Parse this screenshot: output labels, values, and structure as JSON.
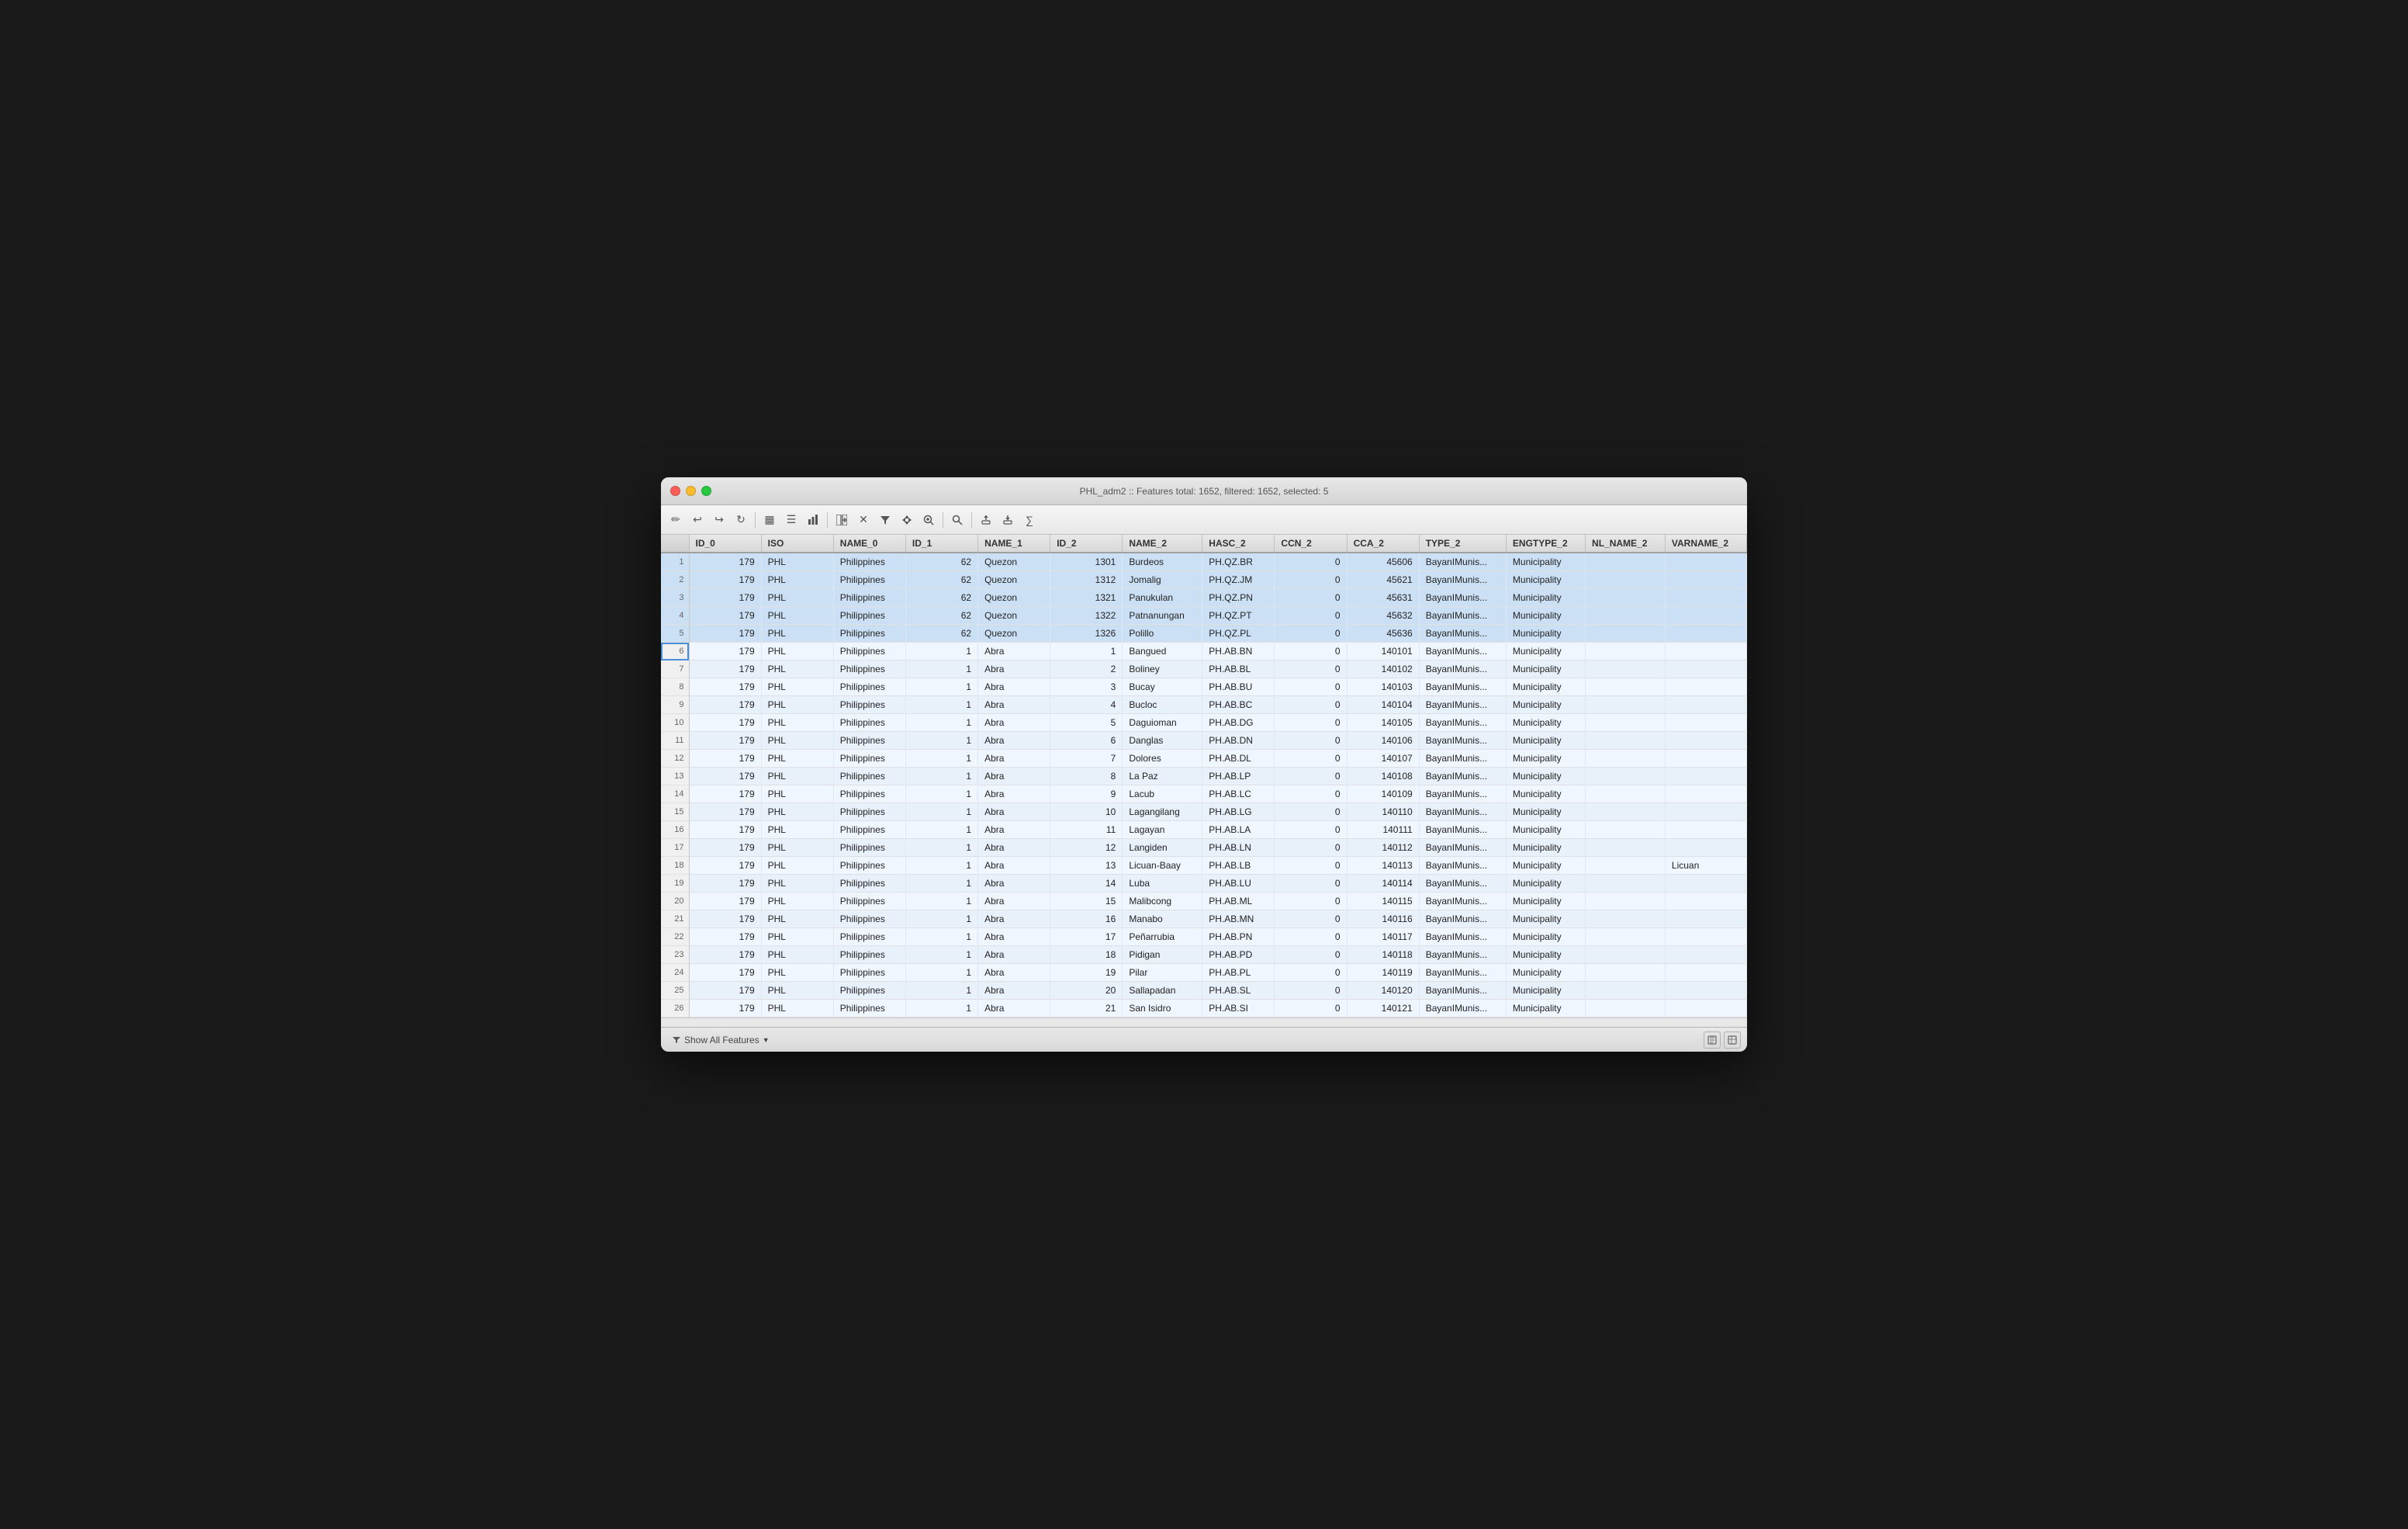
{
  "window": {
    "title": "PHL_adm2 :: Features total: 1652, filtered: 1652, selected: 5"
  },
  "toolbar": {
    "buttons": [
      {
        "name": "pencil-icon",
        "symbol": "✏️"
      },
      {
        "name": "undo-icon",
        "symbol": "↩"
      },
      {
        "name": "redo-icon",
        "symbol": "↪"
      },
      {
        "name": "refresh-icon",
        "symbol": "↻"
      },
      {
        "name": "sep1",
        "type": "separator"
      },
      {
        "name": "table-icon",
        "symbol": "▦"
      },
      {
        "name": "form-icon",
        "symbol": "☰"
      },
      {
        "name": "graph-icon",
        "symbol": "≡"
      },
      {
        "name": "sep2",
        "type": "separator"
      },
      {
        "name": "add-col-icon",
        "symbol": "⊞"
      },
      {
        "name": "delete-icon",
        "symbol": "✕"
      },
      {
        "name": "filter-icon",
        "symbol": "⋮"
      },
      {
        "name": "sep3",
        "type": "separator"
      },
      {
        "name": "move-icon",
        "symbol": "⇄"
      },
      {
        "name": "zoom-icon",
        "symbol": "⊕"
      },
      {
        "name": "sep4",
        "type": "separator"
      },
      {
        "name": "search-icon",
        "symbol": "🔍"
      },
      {
        "name": "sep5",
        "type": "separator"
      },
      {
        "name": "export-icon",
        "symbol": "⬆"
      },
      {
        "name": "import-icon",
        "symbol": "⬇"
      },
      {
        "name": "calc-icon",
        "symbol": "∑"
      }
    ]
  },
  "table": {
    "columns": [
      {
        "id": "ID_0",
        "label": "ID_0",
        "width": 60
      },
      {
        "id": "ISO",
        "label": "ISO",
        "width": 60
      },
      {
        "id": "NAME_0",
        "label": "NAME_0",
        "width": 100
      },
      {
        "id": "ID_1",
        "label": "ID_1",
        "width": 50
      },
      {
        "id": "NAME_1",
        "label": "NAME_1",
        "width": 80
      },
      {
        "id": "ID_2",
        "label": "ID_2",
        "width": 60
      },
      {
        "id": "NAME_2",
        "label": "NAME_2",
        "width": 110
      },
      {
        "id": "HASC_2",
        "label": "HASC_2",
        "width": 90
      },
      {
        "id": "CCN_2",
        "label": "CCN_2",
        "width": 60
      },
      {
        "id": "CCA_2",
        "label": "CCA_2",
        "width": 70
      },
      {
        "id": "TYPE_2",
        "label": "TYPE_2",
        "width": 110
      },
      {
        "id": "ENGTYPE_2",
        "label": "ENGTYPE_2",
        "width": 100
      },
      {
        "id": "NL_NAME_2",
        "label": "NL_NAME_2",
        "width": 100
      },
      {
        "id": "VARNAME_2",
        "label": "VARNAME_2",
        "width": 100
      }
    ],
    "rows": [
      {
        "rowNum": 1,
        "selected": true,
        "ID_0": 179,
        "ISO": "PHL",
        "NAME_0": "Philippines",
        "ID_1": 62,
        "NAME_1": "Quezon",
        "ID_2": 1301,
        "NAME_2": "Burdeos",
        "HASC_2": "PH.QZ.BR",
        "CCN_2": 0,
        "CCA_2": 45606,
        "TYPE_2": "BayanIMunis...",
        "ENGTYPE_2": "Municipality",
        "NL_NAME_2": "",
        "VARNAME_2": ""
      },
      {
        "rowNum": 2,
        "selected": true,
        "ID_0": 179,
        "ISO": "PHL",
        "NAME_0": "Philippines",
        "ID_1": 62,
        "NAME_1": "Quezon",
        "ID_2": 1312,
        "NAME_2": "Jomalig",
        "HASC_2": "PH.QZ.JM",
        "CCN_2": 0,
        "CCA_2": 45621,
        "TYPE_2": "BayanIMunis...",
        "ENGTYPE_2": "Municipality",
        "NL_NAME_2": "",
        "VARNAME_2": ""
      },
      {
        "rowNum": 3,
        "selected": true,
        "ID_0": 179,
        "ISO": "PHL",
        "NAME_0": "Philippines",
        "ID_1": 62,
        "NAME_1": "Quezon",
        "ID_2": 1321,
        "NAME_2": "Panukulan",
        "HASC_2": "PH.QZ.PN",
        "CCN_2": 0,
        "CCA_2": 45631,
        "TYPE_2": "BayanIMunis...",
        "ENGTYPE_2": "Municipality",
        "NL_NAME_2": "",
        "VARNAME_2": ""
      },
      {
        "rowNum": 4,
        "selected": true,
        "ID_0": 179,
        "ISO": "PHL",
        "NAME_0": "Philippines",
        "ID_1": 62,
        "NAME_1": "Quezon",
        "ID_2": 1322,
        "NAME_2": "Patnanungan",
        "HASC_2": "PH.QZ.PT",
        "CCN_2": 0,
        "CCA_2": 45632,
        "TYPE_2": "BayanIMunis...",
        "ENGTYPE_2": "Municipality",
        "NL_NAME_2": "",
        "VARNAME_2": ""
      },
      {
        "rowNum": 5,
        "selected": true,
        "ID_0": 179,
        "ISO": "PHL",
        "NAME_0": "Philippines",
        "ID_1": 62,
        "NAME_1": "Quezon",
        "ID_2": 1326,
        "NAME_2": "Polillo",
        "HASC_2": "PH.QZ.PL",
        "CCN_2": 0,
        "CCA_2": 45636,
        "TYPE_2": "BayanIMunis...",
        "ENGTYPE_2": "Municipality",
        "NL_NAME_2": "",
        "VARNAME_2": ""
      },
      {
        "rowNum": 6,
        "selected": false,
        "focused": true,
        "ID_0": 179,
        "ISO": "PHL",
        "NAME_0": "Philippines",
        "ID_1": 1,
        "NAME_1": "Abra",
        "ID_2": 1,
        "NAME_2": "Bangued",
        "HASC_2": "PH.AB.BN",
        "CCN_2": 0,
        "CCA_2": 140101,
        "TYPE_2": "BayanIMunis...",
        "ENGTYPE_2": "Municipality",
        "NL_NAME_2": "",
        "VARNAME_2": ""
      },
      {
        "rowNum": 7,
        "selected": false,
        "ID_0": 179,
        "ISO": "PHL",
        "NAME_0": "Philippines",
        "ID_1": 1,
        "NAME_1": "Abra",
        "ID_2": 2,
        "NAME_2": "Boliney",
        "HASC_2": "PH.AB.BL",
        "CCN_2": 0,
        "CCA_2": 140102,
        "TYPE_2": "BayanIMunis...",
        "ENGTYPE_2": "Municipality",
        "NL_NAME_2": "",
        "VARNAME_2": ""
      },
      {
        "rowNum": 8,
        "selected": false,
        "ID_0": 179,
        "ISO": "PHL",
        "NAME_0": "Philippines",
        "ID_1": 1,
        "NAME_1": "Abra",
        "ID_2": 3,
        "NAME_2": "Bucay",
        "HASC_2": "PH.AB.BU",
        "CCN_2": 0,
        "CCA_2": 140103,
        "TYPE_2": "BayanIMunis...",
        "ENGTYPE_2": "Municipality",
        "NL_NAME_2": "",
        "VARNAME_2": ""
      },
      {
        "rowNum": 9,
        "selected": false,
        "ID_0": 179,
        "ISO": "PHL",
        "NAME_0": "Philippines",
        "ID_1": 1,
        "NAME_1": "Abra",
        "ID_2": 4,
        "NAME_2": "Bucloc",
        "HASC_2": "PH.AB.BC",
        "CCN_2": 0,
        "CCA_2": 140104,
        "TYPE_2": "BayanIMunis...",
        "ENGTYPE_2": "Municipality",
        "NL_NAME_2": "",
        "VARNAME_2": ""
      },
      {
        "rowNum": 10,
        "selected": false,
        "ID_0": 179,
        "ISO": "PHL",
        "NAME_0": "Philippines",
        "ID_1": 1,
        "NAME_1": "Abra",
        "ID_2": 5,
        "NAME_2": "Daguioman",
        "HASC_2": "PH.AB.DG",
        "CCN_2": 0,
        "CCA_2": 140105,
        "TYPE_2": "BayanIMunis...",
        "ENGTYPE_2": "Municipality",
        "NL_NAME_2": "",
        "VARNAME_2": ""
      },
      {
        "rowNum": 11,
        "selected": false,
        "ID_0": 179,
        "ISO": "PHL",
        "NAME_0": "Philippines",
        "ID_1": 1,
        "NAME_1": "Abra",
        "ID_2": 6,
        "NAME_2": "Danglas",
        "HASC_2": "PH.AB.DN",
        "CCN_2": 0,
        "CCA_2": 140106,
        "TYPE_2": "BayanIMunis...",
        "ENGTYPE_2": "Municipality",
        "NL_NAME_2": "",
        "VARNAME_2": ""
      },
      {
        "rowNum": 12,
        "selected": false,
        "ID_0": 179,
        "ISO": "PHL",
        "NAME_0": "Philippines",
        "ID_1": 1,
        "NAME_1": "Abra",
        "ID_2": 7,
        "NAME_2": "Dolores",
        "HASC_2": "PH.AB.DL",
        "CCN_2": 0,
        "CCA_2": 140107,
        "TYPE_2": "BayanIMunis...",
        "ENGTYPE_2": "Municipality",
        "NL_NAME_2": "",
        "VARNAME_2": ""
      },
      {
        "rowNum": 13,
        "selected": false,
        "ID_0": 179,
        "ISO": "PHL",
        "NAME_0": "Philippines",
        "ID_1": 1,
        "NAME_1": "Abra",
        "ID_2": 8,
        "NAME_2": "La Paz",
        "HASC_2": "PH.AB.LP",
        "CCN_2": 0,
        "CCA_2": 140108,
        "TYPE_2": "BayanIMunis...",
        "ENGTYPE_2": "Municipality",
        "NL_NAME_2": "",
        "VARNAME_2": ""
      },
      {
        "rowNum": 14,
        "selected": false,
        "ID_0": 179,
        "ISO": "PHL",
        "NAME_0": "Philippines",
        "ID_1": 1,
        "NAME_1": "Abra",
        "ID_2": 9,
        "NAME_2": "Lacub",
        "HASC_2": "PH.AB.LC",
        "CCN_2": 0,
        "CCA_2": 140109,
        "TYPE_2": "BayanIMunis...",
        "ENGTYPE_2": "Municipality",
        "NL_NAME_2": "",
        "VARNAME_2": ""
      },
      {
        "rowNum": 15,
        "selected": false,
        "ID_0": 179,
        "ISO": "PHL",
        "NAME_0": "Philippines",
        "ID_1": 1,
        "NAME_1": "Abra",
        "ID_2": 10,
        "NAME_2": "Lagangilang",
        "HASC_2": "PH.AB.LG",
        "CCN_2": 0,
        "CCA_2": 140110,
        "TYPE_2": "BayanIMunis...",
        "ENGTYPE_2": "Municipality",
        "NL_NAME_2": "",
        "VARNAME_2": ""
      },
      {
        "rowNum": 16,
        "selected": false,
        "ID_0": 179,
        "ISO": "PHL",
        "NAME_0": "Philippines",
        "ID_1": 1,
        "NAME_1": "Abra",
        "ID_2": 11,
        "NAME_2": "Lagayan",
        "HASC_2": "PH.AB.LA",
        "CCN_2": 0,
        "CCA_2": 140111,
        "TYPE_2": "BayanIMunis...",
        "ENGTYPE_2": "Municipality",
        "NL_NAME_2": "",
        "VARNAME_2": ""
      },
      {
        "rowNum": 17,
        "selected": false,
        "ID_0": 179,
        "ISO": "PHL",
        "NAME_0": "Philippines",
        "ID_1": 1,
        "NAME_1": "Abra",
        "ID_2": 12,
        "NAME_2": "Langiden",
        "HASC_2": "PH.AB.LN",
        "CCN_2": 0,
        "CCA_2": 140112,
        "TYPE_2": "BayanIMunis...",
        "ENGTYPE_2": "Municipality",
        "NL_NAME_2": "",
        "VARNAME_2": ""
      },
      {
        "rowNum": 18,
        "selected": false,
        "ID_0": 179,
        "ISO": "PHL",
        "NAME_0": "Philippines",
        "ID_1": 1,
        "NAME_1": "Abra",
        "ID_2": 13,
        "NAME_2": "Licuan-Baay",
        "HASC_2": "PH.AB.LB",
        "CCN_2": 0,
        "CCA_2": 140113,
        "TYPE_2": "BayanIMunis...",
        "ENGTYPE_2": "Municipality",
        "NL_NAME_2": "",
        "VARNAME_2": "Licuan"
      },
      {
        "rowNum": 19,
        "selected": false,
        "ID_0": 179,
        "ISO": "PHL",
        "NAME_0": "Philippines",
        "ID_1": 1,
        "NAME_1": "Abra",
        "ID_2": 14,
        "NAME_2": "Luba",
        "HASC_2": "PH.AB.LU",
        "CCN_2": 0,
        "CCA_2": 140114,
        "TYPE_2": "BayanIMunis...",
        "ENGTYPE_2": "Municipality",
        "NL_NAME_2": "",
        "VARNAME_2": ""
      },
      {
        "rowNum": 20,
        "selected": false,
        "ID_0": 179,
        "ISO": "PHL",
        "NAME_0": "Philippines",
        "ID_1": 1,
        "NAME_1": "Abra",
        "ID_2": 15,
        "NAME_2": "Malibcong",
        "HASC_2": "PH.AB.ML",
        "CCN_2": 0,
        "CCA_2": 140115,
        "TYPE_2": "BayanIMunis...",
        "ENGTYPE_2": "Municipality",
        "NL_NAME_2": "",
        "VARNAME_2": ""
      },
      {
        "rowNum": 21,
        "selected": false,
        "ID_0": 179,
        "ISO": "PHL",
        "NAME_0": "Philippines",
        "ID_1": 1,
        "NAME_1": "Abra",
        "ID_2": 16,
        "NAME_2": "Manabo",
        "HASC_2": "PH.AB.MN",
        "CCN_2": 0,
        "CCA_2": 140116,
        "TYPE_2": "BayanIMunis...",
        "ENGTYPE_2": "Municipality",
        "NL_NAME_2": "",
        "VARNAME_2": ""
      },
      {
        "rowNum": 22,
        "selected": false,
        "ID_0": 179,
        "ISO": "PHL",
        "NAME_0": "Philippines",
        "ID_1": 1,
        "NAME_1": "Abra",
        "ID_2": 17,
        "NAME_2": "Peñarrubia",
        "HASC_2": "PH.AB.PN",
        "CCN_2": 0,
        "CCA_2": 140117,
        "TYPE_2": "BayanIMunis...",
        "ENGTYPE_2": "Municipality",
        "NL_NAME_2": "",
        "VARNAME_2": ""
      },
      {
        "rowNum": 23,
        "selected": false,
        "ID_0": 179,
        "ISO": "PHL",
        "NAME_0": "Philippines",
        "ID_1": 1,
        "NAME_1": "Abra",
        "ID_2": 18,
        "NAME_2": "Pidigan",
        "HASC_2": "PH.AB.PD",
        "CCN_2": 0,
        "CCA_2": 140118,
        "TYPE_2": "BayanIMunis...",
        "ENGTYPE_2": "Municipality",
        "NL_NAME_2": "",
        "VARNAME_2": ""
      },
      {
        "rowNum": 24,
        "selected": false,
        "ID_0": 179,
        "ISO": "PHL",
        "NAME_0": "Philippines",
        "ID_1": 1,
        "NAME_1": "Abra",
        "ID_2": 19,
        "NAME_2": "Pilar",
        "HASC_2": "PH.AB.PL",
        "CCN_2": 0,
        "CCA_2": 140119,
        "TYPE_2": "BayanIMunis...",
        "ENGTYPE_2": "Municipality",
        "NL_NAME_2": "",
        "VARNAME_2": ""
      },
      {
        "rowNum": 25,
        "selected": false,
        "ID_0": 179,
        "ISO": "PHL",
        "NAME_0": "Philippines",
        "ID_1": 1,
        "NAME_1": "Abra",
        "ID_2": 20,
        "NAME_2": "Sallapadan",
        "HASC_2": "PH.AB.SL",
        "CCN_2": 0,
        "CCA_2": 140120,
        "TYPE_2": "BayanIMunis...",
        "ENGTYPE_2": "Municipality",
        "NL_NAME_2": "",
        "VARNAME_2": ""
      },
      {
        "rowNum": 26,
        "selected": false,
        "ID_0": 179,
        "ISO": "PHL",
        "NAME_0": "Philippines",
        "ID_1": 1,
        "NAME_1": "Abra",
        "ID_2": 21,
        "NAME_2": "San Isidro",
        "HASC_2": "PH.AB.SI",
        "CCN_2": 0,
        "CCA_2": 140121,
        "TYPE_2": "BayanIMunis...",
        "ENGTYPE_2": "Municipality",
        "NL_NAME_2": "",
        "VARNAME_2": ""
      }
    ]
  },
  "footer": {
    "show_all_label": "Show All Features",
    "dropdown_icon": "▼"
  }
}
